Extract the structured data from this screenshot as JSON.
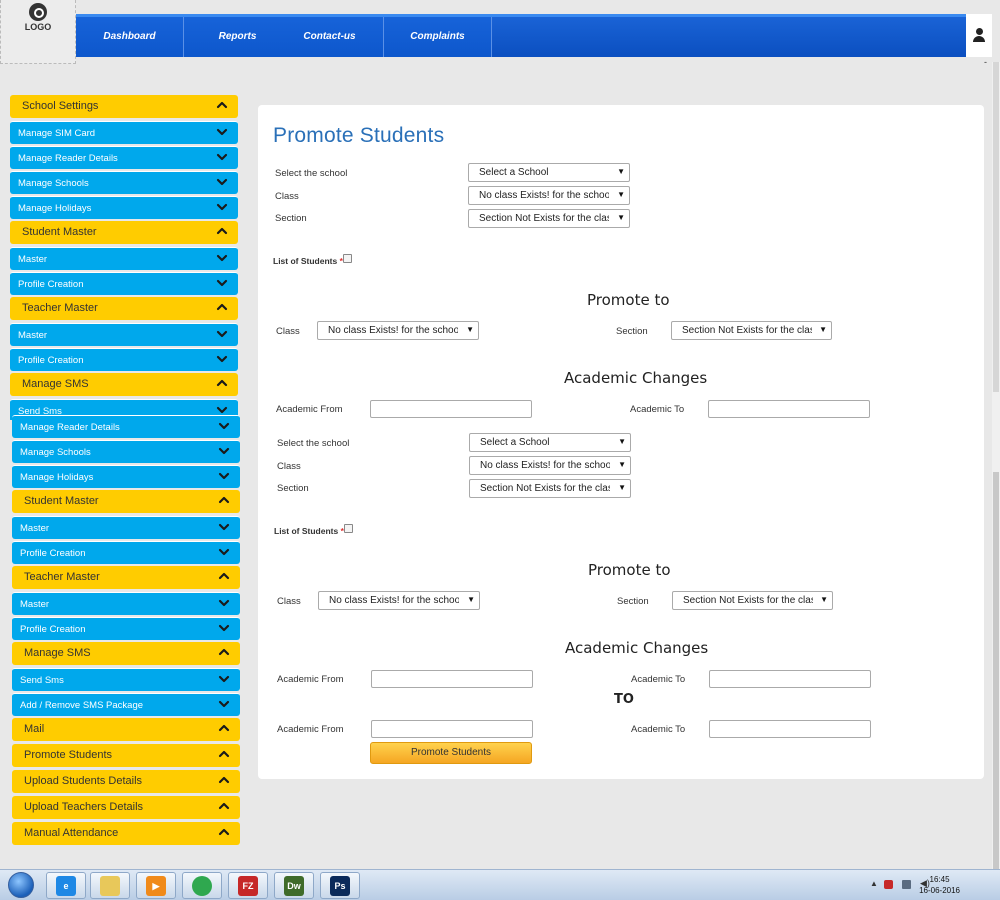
{
  "header": {
    "logo_text": "LOGO",
    "nav": [
      "Dashboard",
      "Reports",
      "Contact-us",
      "Complaints"
    ],
    "scroll_marker": "-"
  },
  "sidebar_top": [
    {
      "label": "School Settings",
      "kind": "hdr",
      "icon": "chevron-up-icon"
    },
    {
      "label": "Manage SIM Card",
      "kind": "sub",
      "icon": "chevron-down-icon"
    },
    {
      "label": "Manage Reader Details",
      "kind": "sub",
      "icon": "chevron-down-icon"
    },
    {
      "label": "Manage Schools",
      "kind": "sub",
      "icon": "chevron-down-icon"
    },
    {
      "label": "Manage Holidays",
      "kind": "sub",
      "icon": "chevron-down-icon"
    },
    {
      "label": "Student Master",
      "kind": "hdr",
      "icon": "chevron-up-icon"
    },
    {
      "label": "Master",
      "kind": "sub",
      "icon": "chevron-down-icon"
    },
    {
      "label": "Profile Creation",
      "kind": "sub",
      "icon": "chevron-down-icon"
    },
    {
      "label": "Teacher Master",
      "kind": "hdr",
      "icon": "chevron-up-icon"
    },
    {
      "label": "Master",
      "kind": "sub",
      "icon": "chevron-down-icon"
    },
    {
      "label": "Profile Creation",
      "kind": "sub",
      "icon": "chevron-down-icon"
    },
    {
      "label": "Manage SMS",
      "kind": "hdr",
      "icon": "chevron-up-icon"
    },
    {
      "label": "Send Sms",
      "kind": "sub",
      "icon": "chevron-down-icon"
    }
  ],
  "sidebar_bottom": [
    {
      "label": "Manage Reader Details",
      "kind": "sub",
      "icon": "chevron-down-icon"
    },
    {
      "label": "Manage Schools",
      "kind": "sub",
      "icon": "chevron-down-icon"
    },
    {
      "label": "Manage Holidays",
      "kind": "sub",
      "icon": "chevron-down-icon"
    },
    {
      "label": "Student Master",
      "kind": "hdr",
      "icon": "chevron-up-icon"
    },
    {
      "label": "Master",
      "kind": "sub",
      "icon": "chevron-down-icon"
    },
    {
      "label": "Profile Creation",
      "kind": "sub",
      "icon": "chevron-down-icon"
    },
    {
      "label": "Teacher Master",
      "kind": "hdr",
      "icon": "chevron-up-icon"
    },
    {
      "label": "Master",
      "kind": "sub",
      "icon": "chevron-down-icon"
    },
    {
      "label": "Profile Creation",
      "kind": "sub",
      "icon": "chevron-down-icon"
    },
    {
      "label": "Manage SMS",
      "kind": "hdr",
      "icon": "chevron-up-icon"
    },
    {
      "label": "Send Sms",
      "kind": "sub",
      "icon": "chevron-down-icon"
    },
    {
      "label": "Add / Remove SMS Package",
      "kind": "sub",
      "icon": "chevron-down-icon"
    },
    {
      "label": "Mail",
      "kind": "hdr",
      "icon": "chevron-up-icon"
    },
    {
      "label": "Promote Students",
      "kind": "hdr",
      "icon": "chevron-up-icon"
    },
    {
      "label": "Upload Students Details",
      "kind": "hdr",
      "icon": "chevron-up-icon"
    },
    {
      "label": "Upload Teachers Details",
      "kind": "hdr",
      "icon": "chevron-up-icon"
    },
    {
      "label": "Manual Attendance",
      "kind": "hdr",
      "icon": "chevron-up-icon"
    }
  ],
  "main": {
    "title": "Promote Students",
    "form_a": {
      "select_school_label": "Select the school",
      "select_school_value": "Select a School",
      "class_label": "Class",
      "class_value": "No class Exists! for the schoo",
      "section_label": "Section",
      "section_value": "Section Not Exists for the clas",
      "list_label": "List of Students",
      "required_mark": "*",
      "promote_to": "Promote to",
      "pt_class_label": "Class",
      "pt_class_value": "No class Exists! for the schoo",
      "pt_section_label": "Section",
      "pt_section_value": "Section Not Exists for the clas",
      "academic_changes": "Academic Changes",
      "academic_from": "Academic From",
      "academic_to": "Academic To"
    },
    "form_b": {
      "select_school_label": "Select the school",
      "select_school_value": "Select a School",
      "class_label": "Class",
      "class_value": "No class Exists! for the schoo",
      "section_label": "Section",
      "section_value": "Section Not Exists for the clas",
      "list_label": "List of Students",
      "required_mark": "*",
      "promote_to": "Promote to",
      "pt_class_label": "Class",
      "pt_class_value": "No class Exists! for the schoo",
      "pt_section_label": "Section",
      "pt_section_value": "Section Not Exists for the clas",
      "academic_changes": "Academic Changes",
      "academic_from": "Academic From",
      "academic_to": "Academic To",
      "to_label": "TO",
      "academic_from_2": "Academic From",
      "academic_to_2": "Academic To",
      "submit": "Promote Students"
    }
  },
  "taskbar": {
    "time": "16:45",
    "date": "16-06-2016",
    "apps": [
      {
        "icon": "internet-explorer-icon",
        "text": "e",
        "color": "#1e88e5"
      },
      {
        "icon": "folder-icon",
        "text": "",
        "color": "#e8c85a"
      },
      {
        "icon": "media-player-icon",
        "text": "▶",
        "color": "#f08a1a"
      },
      {
        "icon": "chrome-icon",
        "text": "",
        "color": "#2fa84f"
      },
      {
        "icon": "filezilla-icon",
        "text": "FZ",
        "color": "#c62828"
      },
      {
        "icon": "dreamweaver-icon",
        "text": "Dw",
        "color": "#3f6b2a"
      },
      {
        "icon": "photoshop-icon",
        "text": "Ps",
        "color": "#0b2a5a"
      }
    ]
  }
}
